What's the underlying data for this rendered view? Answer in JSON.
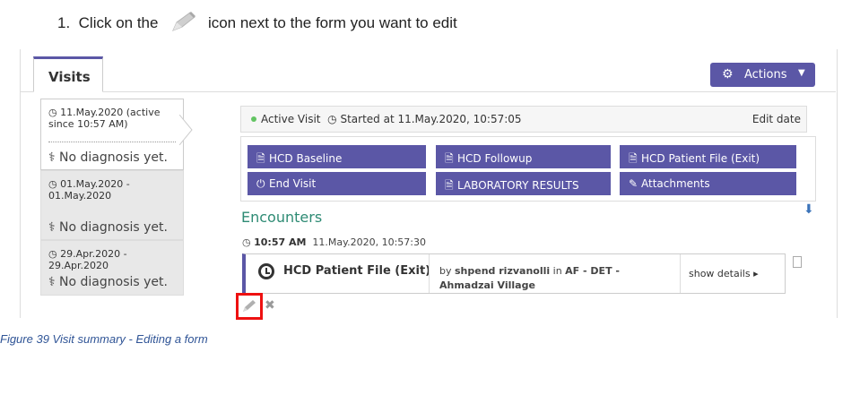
{
  "instruction": {
    "number": "1.",
    "before_icon": "Click on the",
    "after_icon": "icon next to the form you want to edit",
    "icon": "pencil-icon"
  },
  "tab": {
    "label": "Visits"
  },
  "actions_button": {
    "label": "Actions",
    "icon": "gear-icon"
  },
  "visits": [
    {
      "date": "11.May.2020 (active since 10:57 AM)",
      "diagnosis": "No diagnosis yet.",
      "active": true
    },
    {
      "date": "01.May.2020 - 01.May.2020",
      "diagnosis": "No diagnosis yet.",
      "active": false
    },
    {
      "date": "29.Apr.2020 - 29.Apr.2020",
      "diagnosis": "No diagnosis yet.",
      "active": false
    }
  ],
  "status": {
    "active_label": "Active Visit",
    "started": "Started at 11.May.2020, 10:57:05",
    "edit_date": "Edit date"
  },
  "form_buttons": [
    {
      "label": "HCD Baseline",
      "icon": "document-icon"
    },
    {
      "label": "HCD Followup",
      "icon": "document-icon"
    },
    {
      "label": "HCD Patient File (Exit)",
      "icon": "document-icon"
    },
    {
      "label": "End Visit",
      "icon": "power-icon"
    },
    {
      "label": "LABORATORY RESULTS",
      "icon": "document-icon"
    },
    {
      "label": "Attachments",
      "icon": "paperclip-icon"
    }
  ],
  "encounters": {
    "heading": "Encounters",
    "time_bold": "10:57 AM",
    "time_rest": "11.May.2020, 10:57:30",
    "card": {
      "title": "HCD Patient File (Exit)",
      "by_prefix": "by",
      "user": "shpend rizvanolli",
      "in_word": "in",
      "location": "AF - DET - Ahmadzai Village",
      "details": "show details"
    }
  },
  "caption": "Figure 39 Visit summary - Editing a form",
  "colors": {
    "accent": "#5b57a6",
    "highlight_box": "#ee1111",
    "heading_green": "#2e8b74",
    "caption_blue": "#2f5496"
  }
}
